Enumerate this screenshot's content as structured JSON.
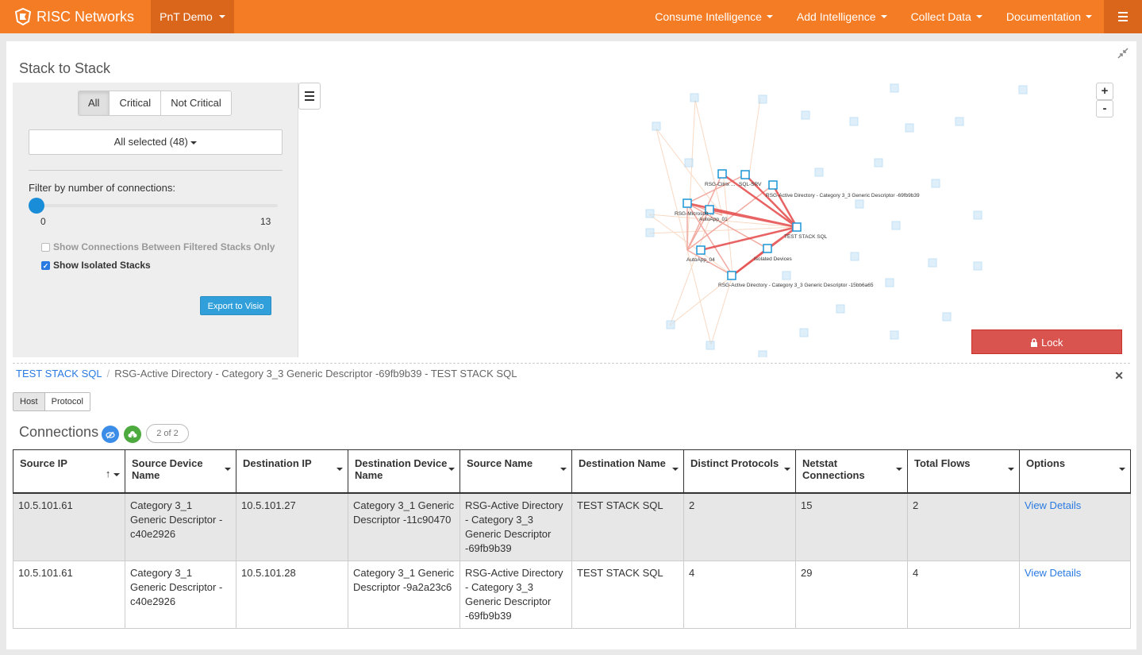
{
  "nav": {
    "brand": "RISC Networks",
    "org": "PnT Demo",
    "menus": [
      "Consume Intelligence",
      "Add Intelligence",
      "Collect Data",
      "Documentation"
    ]
  },
  "panel": {
    "title": "Stack to Stack",
    "filter_segments": [
      "All",
      "Critical",
      "Not Critical"
    ],
    "active_segment": "All",
    "stack_select": "All selected (48)",
    "filter_label": "Filter by number of connections:",
    "slider": {
      "min": "0",
      "max": "13",
      "value": 0
    },
    "check_connections": "Show Connections Between Filtered Stacks Only",
    "check_isolated": "Show Isolated Stacks",
    "export_button": "Export to Visio",
    "lock_button": "Lock",
    "zoom_in": "+",
    "zoom_out": "-"
  },
  "graph": {
    "labeled_nodes": [
      "RSG-Citrix ...",
      "SQL-SRV",
      "RSG-Active Directory - Category 3_3 Generic Descriptor -69fb9b39",
      "RSG-Microsoft ...",
      "AutoApp_01",
      "TEST STACK SQL",
      "AutoApp_04",
      "Isolated Devices",
      "RSG-Active Directory - Category 3_3 Generic Descriptor -15bb6a65"
    ]
  },
  "breadcrumb": {
    "root": "TEST STACK SQL",
    "current": "RSG-Active Directory - Category 3_3 Generic Descriptor -69fb9b39 - TEST STACK SQL"
  },
  "tabs": [
    "Host",
    "Protocol"
  ],
  "connections": {
    "title": "Connections",
    "count": "2 of 2",
    "columns": [
      "Source IP",
      "Source Device Name",
      "Destination IP",
      "Destination Device Name",
      "Source Name",
      "Destination Name",
      "Distinct Protocols",
      "Netstat Connections",
      "Total Flows",
      "Options"
    ],
    "rows": [
      [
        "10.5.101.61",
        "Category 3_1 Generic Descriptor -c40e2926",
        "10.5.101.27",
        "Category 3_1 Generic Descriptor -11c90470",
        "RSG-Active Directory - Category 3_3 Generic Descriptor -69fb9b39",
        "TEST STACK SQL",
        "2",
        "15",
        "2",
        "View Details"
      ],
      [
        "10.5.101.61",
        "Category 3_1 Generic Descriptor -c40e2926",
        "10.5.101.28",
        "Category 3_1 Generic Descriptor -9a2a23c6",
        "RSG-Active Directory - Category 3_3 Generic Descriptor -69fb9b39",
        "TEST STACK SQL",
        "4",
        "29",
        "4",
        "View Details"
      ]
    ]
  }
}
